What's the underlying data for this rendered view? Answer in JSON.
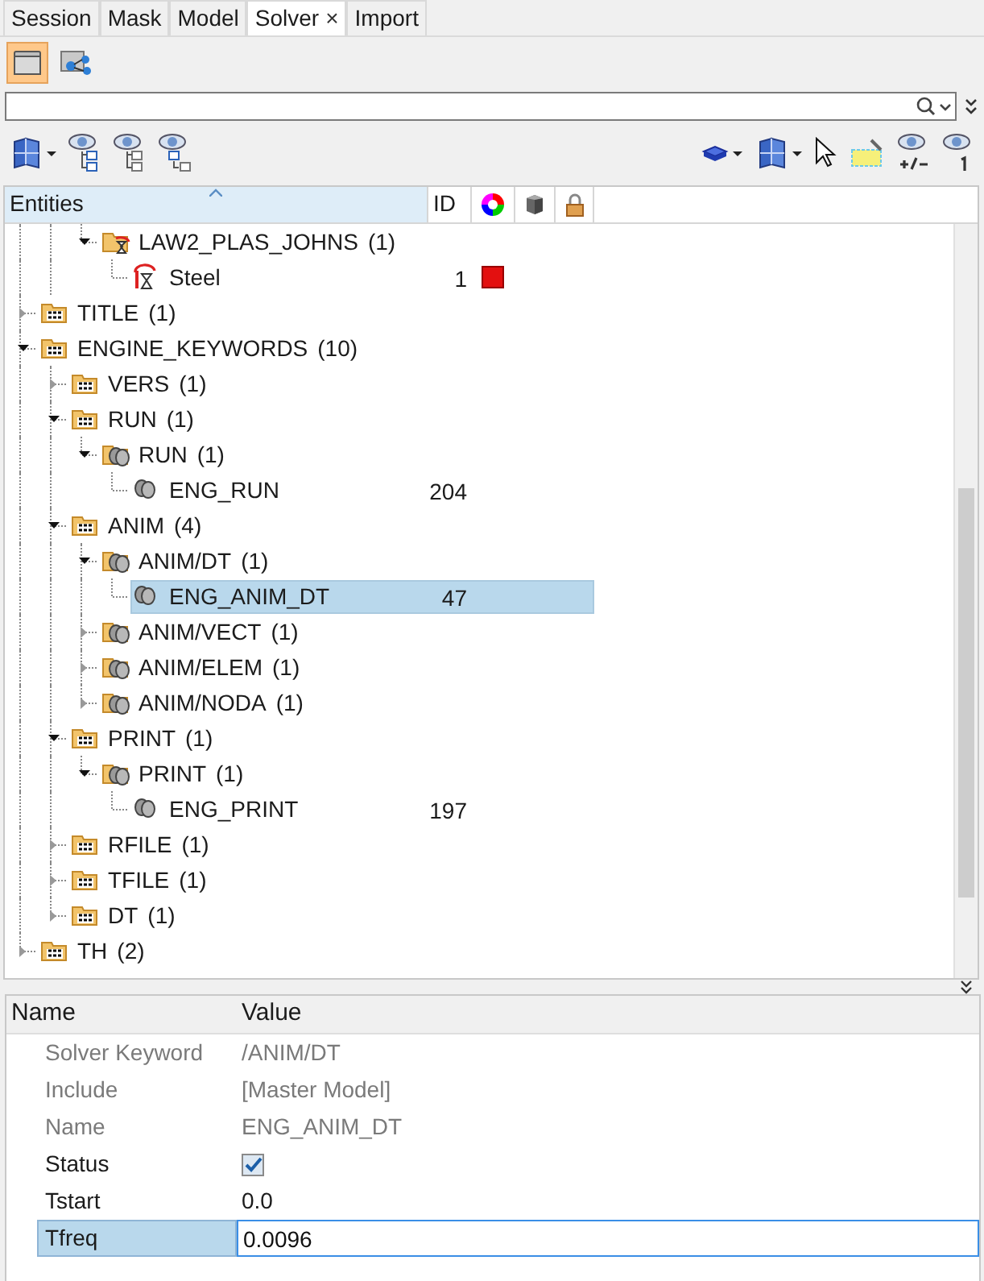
{
  "tabs": [
    {
      "label": "Session",
      "selected": false
    },
    {
      "label": "Mask",
      "selected": false
    },
    {
      "label": "Model",
      "selected": false
    },
    {
      "label": "Solver",
      "selected": true,
      "close_glyph": "×"
    },
    {
      "label": "Import",
      "selected": false
    }
  ],
  "view_buttons": [
    {
      "kind": "folder",
      "selected": true
    },
    {
      "kind": "hierarchy",
      "selected": false
    }
  ],
  "tree": {
    "columns": [
      {
        "kind": "text",
        "label": "Entities",
        "sorted": true
      },
      {
        "kind": "text",
        "label": "ID",
        "sorted": false
      },
      {
        "kind": "color"
      },
      {
        "kind": "cube"
      },
      {
        "kind": "lock"
      }
    ],
    "scrolled_branch": {
      "children": [
        {
          "kind": "material-folder",
          "label": "LAW2_PLAS_JOHNS",
          "count": "(1)",
          "expanded": true,
          "selected": false,
          "children": [
            {
              "kind": "material",
              "label": "Steel",
              "id": "1",
              "color": "#e31010",
              "selected": false
            }
          ]
        }
      ]
    },
    "items": [
      {
        "kind": "keyword-folder",
        "label": "TITLE",
        "count": "(1)",
        "expanded": false,
        "selected": false
      },
      {
        "kind": "keyword-folder",
        "label": "ENGINE_KEYWORDS",
        "count": "(10)",
        "expanded": true,
        "selected": false,
        "children": [
          {
            "kind": "keyword-folder",
            "label": "VERS",
            "count": "(1)",
            "expanded": false,
            "selected": false
          },
          {
            "kind": "keyword-folder",
            "label": "RUN",
            "count": "(1)",
            "expanded": true,
            "selected": false,
            "children": [
              {
                "kind": "card-folder",
                "label": "RUN",
                "count": "(1)",
                "expanded": true,
                "selected": false,
                "children": [
                  {
                    "kind": "card",
                    "label": "ENG_RUN",
                    "id": "204",
                    "selected": false
                  }
                ]
              }
            ]
          },
          {
            "kind": "keyword-folder",
            "label": "ANIM",
            "count": "(4)",
            "expanded": true,
            "selected": false,
            "children": [
              {
                "kind": "card-folder",
                "label": "ANIM/DT",
                "count": "(1)",
                "expanded": true,
                "selected": false,
                "children": [
                  {
                    "kind": "card",
                    "label": "ENG_ANIM_DT",
                    "id": "47",
                    "selected": true
                  }
                ]
              },
              {
                "kind": "card-folder",
                "label": "ANIM/VECT",
                "count": "(1)",
                "expanded": false,
                "selected": false
              },
              {
                "kind": "card-folder",
                "label": "ANIM/ELEM",
                "count": "(1)",
                "expanded": false,
                "selected": false
              },
              {
                "kind": "card-folder",
                "label": "ANIM/NODA",
                "count": "(1)",
                "expanded": false,
                "selected": false
              }
            ]
          },
          {
            "kind": "keyword-folder",
            "label": "PRINT",
            "count": "(1)",
            "expanded": true,
            "selected": false,
            "children": [
              {
                "kind": "card-folder",
                "label": "PRINT",
                "count": "(1)",
                "expanded": true,
                "selected": false,
                "children": [
                  {
                    "kind": "card",
                    "label": "ENG_PRINT",
                    "id": "197",
                    "selected": false
                  }
                ]
              }
            ]
          },
          {
            "kind": "keyword-folder",
            "label": "RFILE",
            "count": "(1)",
            "expanded": false,
            "selected": false
          },
          {
            "kind": "keyword-folder",
            "label": "TFILE",
            "count": "(1)",
            "expanded": false,
            "selected": false
          },
          {
            "kind": "keyword-folder",
            "label": "DT",
            "count": "(1)",
            "expanded": false,
            "selected": false
          }
        ]
      },
      {
        "kind": "keyword-folder",
        "label": "TH",
        "count": "(2)",
        "expanded": false,
        "selected": false
      }
    ]
  },
  "properties": {
    "columns": [
      "Name",
      "Value"
    ],
    "rows": [
      {
        "kind": "readonly",
        "name": "Solver Keyword",
        "value": "/ANIM/DT",
        "selected": false
      },
      {
        "kind": "readonly",
        "name": "Include",
        "value": "[Master Model]",
        "selected": false
      },
      {
        "kind": "readonly",
        "name": "Name",
        "value": "ENG_ANIM_DT",
        "selected": false
      },
      {
        "kind": "checkbox",
        "name": "Status",
        "checked": true,
        "selected": false
      },
      {
        "kind": "text",
        "name": "Tstart",
        "value": "0.0",
        "selected": false
      },
      {
        "kind": "text",
        "name": "Tfreq",
        "value": "0.0096",
        "selected": true
      }
    ]
  }
}
